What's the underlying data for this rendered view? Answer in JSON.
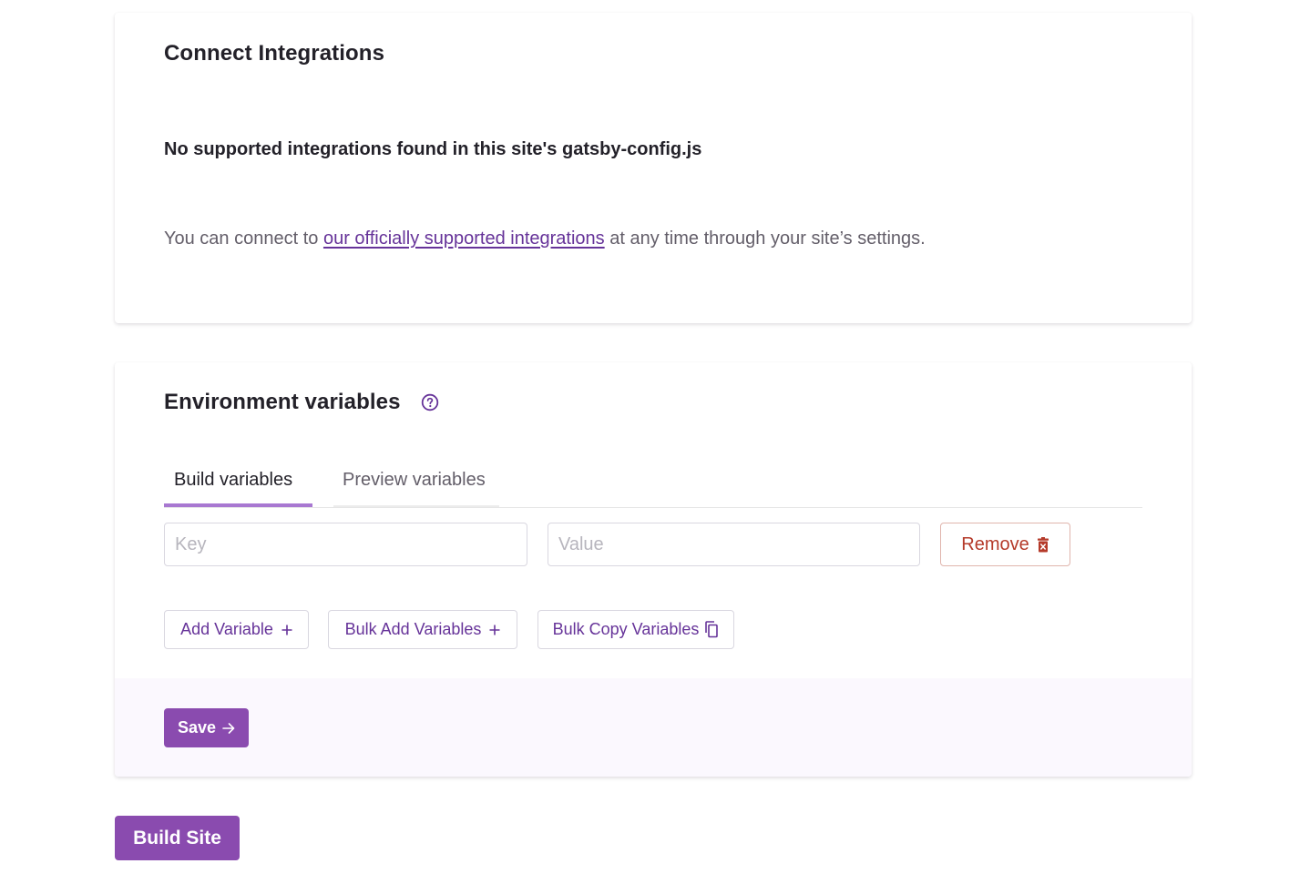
{
  "integrations": {
    "title": "Connect Integrations",
    "subheading": "No supported integrations found in this site's gatsby-config.js",
    "body_prefix": "You can connect to ",
    "link_text": "our officially supported integrations",
    "body_suffix": " at any time through your site’s settings."
  },
  "env": {
    "title": "Environment variables",
    "help_icon": "question-circle-icon",
    "tabs": [
      {
        "label": "Build variables",
        "active": true
      },
      {
        "label": "Preview variables",
        "active": false
      }
    ],
    "key_placeholder": "Key",
    "value_placeholder": "Value",
    "remove_label": "Remove",
    "remove_icon": "trash-icon",
    "add_variable_label": "Add Variable",
    "bulk_add_label": "Bulk Add Variables",
    "bulk_copy_label": "Bulk Copy Variables",
    "copy_icon": "copy-icon",
    "save_label": "Save"
  },
  "build_site_label": "Build Site",
  "colors": {
    "accent": "#663399",
    "primary_button": "#8a4baf",
    "danger": "#b53a2a",
    "active_tab_underline": "#a878d1"
  }
}
